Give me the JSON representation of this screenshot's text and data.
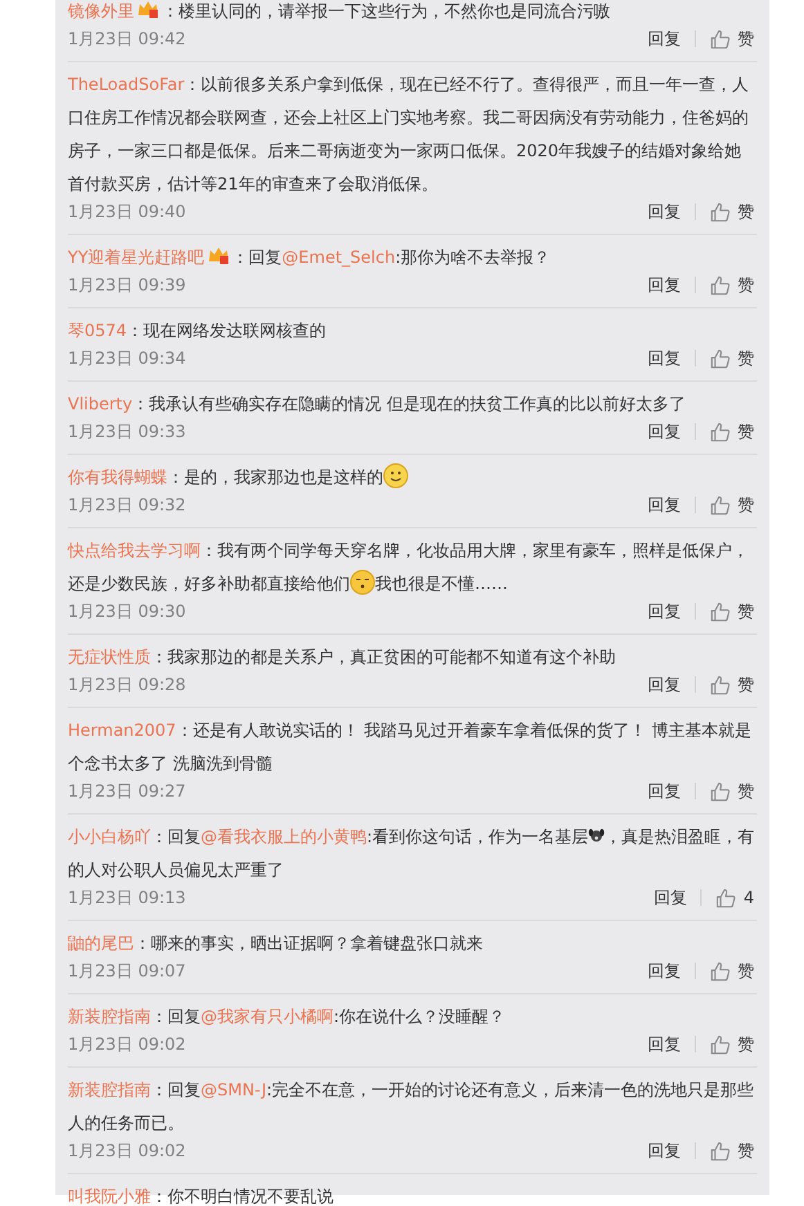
{
  "comments": [
    {
      "author": "镜像外里",
      "badge": true,
      "segments": [
        {
          "kind": "text",
          "text": "：楼里认同的，请举报一下这些行为，不然你也是同流合污嗷"
        }
      ],
      "time": "1月23日 09:42",
      "reply": "回复",
      "like": "赞"
    },
    {
      "author": "TheLoadSoFar",
      "badge": false,
      "segments": [
        {
          "kind": "text",
          "text": "：以前很多关系户拿到低保，现在已经不行了。查得很严，而且一年一查，人口住房工作情况都会联网查，还会上社区上门实地考察。我二哥因病没有劳动能力，住爸妈的房子，一家三口都是低保。后来二哥病逝变为一家两口低保。2020年我嫂子的结婚对象给她首付款买房，估计等21年的审查来了会取消低保。"
        }
      ],
      "time": "1月23日 09:40",
      "reply": "回复",
      "like": "赞"
    },
    {
      "author": "YY迎着星光赶路吧",
      "badge": true,
      "segments": [
        {
          "kind": "text",
          "text": "：回复"
        },
        {
          "kind": "mention",
          "text": "@Emet_Selch"
        },
        {
          "kind": "text",
          "text": ":那你为啥不去举报？"
        }
      ],
      "time": "1月23日 09:39",
      "reply": "回复",
      "like": "赞"
    },
    {
      "author": "琴0574",
      "badge": false,
      "segments": [
        {
          "kind": "text",
          "text": "：现在网络发达联网核查的"
        }
      ],
      "time": "1月23日 09:34",
      "reply": "回复",
      "like": "赞"
    },
    {
      "author": "Vliberty",
      "badge": false,
      "segments": [
        {
          "kind": "text",
          "text": "：我承认有些确实存在隐瞒的情况 但是现在的扶贫工作真的比以前好太多了"
        }
      ],
      "time": "1月23日 09:33",
      "reply": "回复",
      "like": "赞"
    },
    {
      "author": "你有我得蝴蝶",
      "badge": false,
      "segments": [
        {
          "kind": "text",
          "text": "：是的，我家那边也是这样的"
        },
        {
          "kind": "smile"
        }
      ],
      "time": "1月23日 09:32",
      "reply": "回复",
      "like": "赞"
    },
    {
      "author": "快点给我去学习啊",
      "badge": false,
      "segments": [
        {
          "kind": "text",
          "text": "：我有两个同学每天穿名牌，化妆品用大牌，家里有豪车，照样是低保户，还是少数民族，好多补助都直接给他们"
        },
        {
          "kind": "squint"
        },
        {
          "kind": "text",
          "text": "我也很是不懂……"
        }
      ],
      "time": "1月23日 09:30",
      "reply": "回复",
      "like": "赞"
    },
    {
      "author": "无症状性质",
      "badge": false,
      "segments": [
        {
          "kind": "text",
          "text": "：我家那边的都是关系户，真正贫困的可能都不知道有这个补助"
        }
      ],
      "time": "1月23日 09:28",
      "reply": "回复",
      "like": "赞"
    },
    {
      "author": "Herman2007",
      "badge": false,
      "segments": [
        {
          "kind": "text",
          "text": "：还是有人敢说实话的！ 我踏马见过开着豪车拿着低保的货了！ 博主基本就是个念书太多了 洗脑洗到骨髓"
        }
      ],
      "time": "1月23日 09:27",
      "reply": "回复",
      "like": "赞"
    },
    {
      "author": "小小白杨吖",
      "badge": false,
      "segments": [
        {
          "kind": "text",
          "text": "：回复"
        },
        {
          "kind": "mention",
          "text": "@看我衣服上的小黄鸭"
        },
        {
          "kind": "text",
          "text": ":看到你这句话，作为一名基层"
        },
        {
          "kind": "dog"
        },
        {
          "kind": "text",
          "text": "，真是热泪盈眶，有的人对公职人员偏见太严重了"
        }
      ],
      "time": "1月23日 09:13",
      "reply": "回复",
      "like": "4"
    },
    {
      "author": "鼬的尾巴",
      "badge": false,
      "segments": [
        {
          "kind": "text",
          "text": "：哪来的事实，晒出证据啊？拿着键盘张口就来"
        }
      ],
      "time": "1月23日 09:07",
      "reply": "回复",
      "like": "赞"
    },
    {
      "author": "新装腔指南",
      "badge": false,
      "segments": [
        {
          "kind": "text",
          "text": "：回复"
        },
        {
          "kind": "mention",
          "text": "@我家有只小橘啊"
        },
        {
          "kind": "text",
          "text": ":你在说什么？没睡醒？"
        }
      ],
      "time": "1月23日 09:02",
      "reply": "回复",
      "like": "赞"
    },
    {
      "author": "新装腔指南",
      "badge": false,
      "segments": [
        {
          "kind": "text",
          "text": "：回复"
        },
        {
          "kind": "mention",
          "text": "@SMN-J"
        },
        {
          "kind": "text",
          "text": ":完全不在意，一开始的讨论还有意义，后来清一色的洗地只是那些人的任务而已。"
        }
      ],
      "time": "1月23日 09:02",
      "reply": "回复",
      "like": "赞"
    },
    {
      "author": "叫我阮小雅",
      "badge": false,
      "segments": [
        {
          "kind": "text",
          "text": "：你不明白情况不要乱说"
        }
      ]
    }
  ]
}
